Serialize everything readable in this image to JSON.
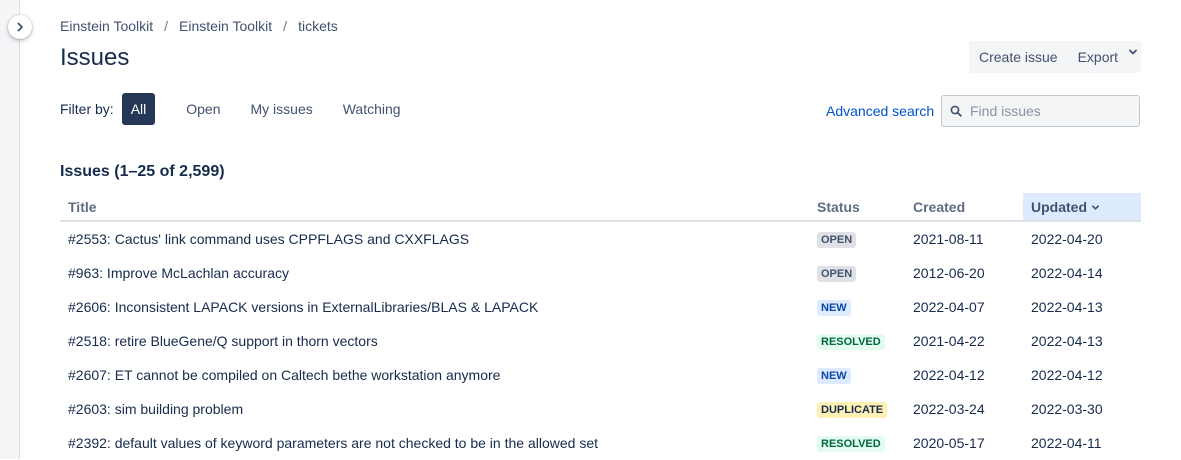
{
  "breadcrumbs": [
    "Einstein Toolkit",
    "Einstein Toolkit",
    "tickets"
  ],
  "breadcrumb_separator": "/",
  "page_title": "Issues",
  "actions": {
    "create_issue": "Create issue",
    "export": "Export"
  },
  "filter": {
    "label": "Filter by:",
    "options": [
      "All",
      "Open",
      "My issues",
      "Watching"
    ],
    "selected": "All"
  },
  "advanced_search": "Advanced search",
  "search": {
    "placeholder": "Find issues",
    "value": ""
  },
  "issues_heading": "Issues (1–25 of 2,599)",
  "table": {
    "columns": {
      "title": "Title",
      "status": "Status",
      "created": "Created",
      "updated": "Updated"
    },
    "sorted_by": "Updated",
    "rows": [
      {
        "title": "#2553: Cactus' link command uses CPPFLAGS and CXXFLAGS",
        "status": "OPEN",
        "created": "2021-08-11",
        "updated": "2022-04-20"
      },
      {
        "title": "#963: Improve McLachlan accuracy",
        "status": "OPEN",
        "created": "2012-06-20",
        "updated": "2022-04-14"
      },
      {
        "title": "#2606: Inconsistent LAPACK versions in ExternalLibraries/BLAS & LAPACK",
        "status": "NEW",
        "created": "2022-04-07",
        "updated": "2022-04-13"
      },
      {
        "title": "#2518: retire BlueGene/Q support in thorn vectors",
        "status": "RESOLVED",
        "created": "2021-04-22",
        "updated": "2022-04-13"
      },
      {
        "title": "#2607: ET cannot be compiled on Caltech bethe workstation anymore",
        "status": "NEW",
        "created": "2022-04-12",
        "updated": "2022-04-12"
      },
      {
        "title": "#2603: sim building problem",
        "status": "DUPLICATE",
        "created": "2022-03-24",
        "updated": "2022-03-30"
      },
      {
        "title": "#2392: default values of keyword parameters are not checked to be in the allowed set",
        "status": "RESOLVED",
        "created": "2020-05-17",
        "updated": "2022-04-11"
      }
    ]
  },
  "colors": {
    "primary": "#0052cc",
    "selected_filter_bg": "#253858",
    "sorted_header_bg": "#deebff"
  },
  "icons": {
    "collapse": "chevron-right-icon",
    "export_dropdown": "chevron-down-icon",
    "search": "search-icon",
    "sort": "chevron-down-icon"
  }
}
